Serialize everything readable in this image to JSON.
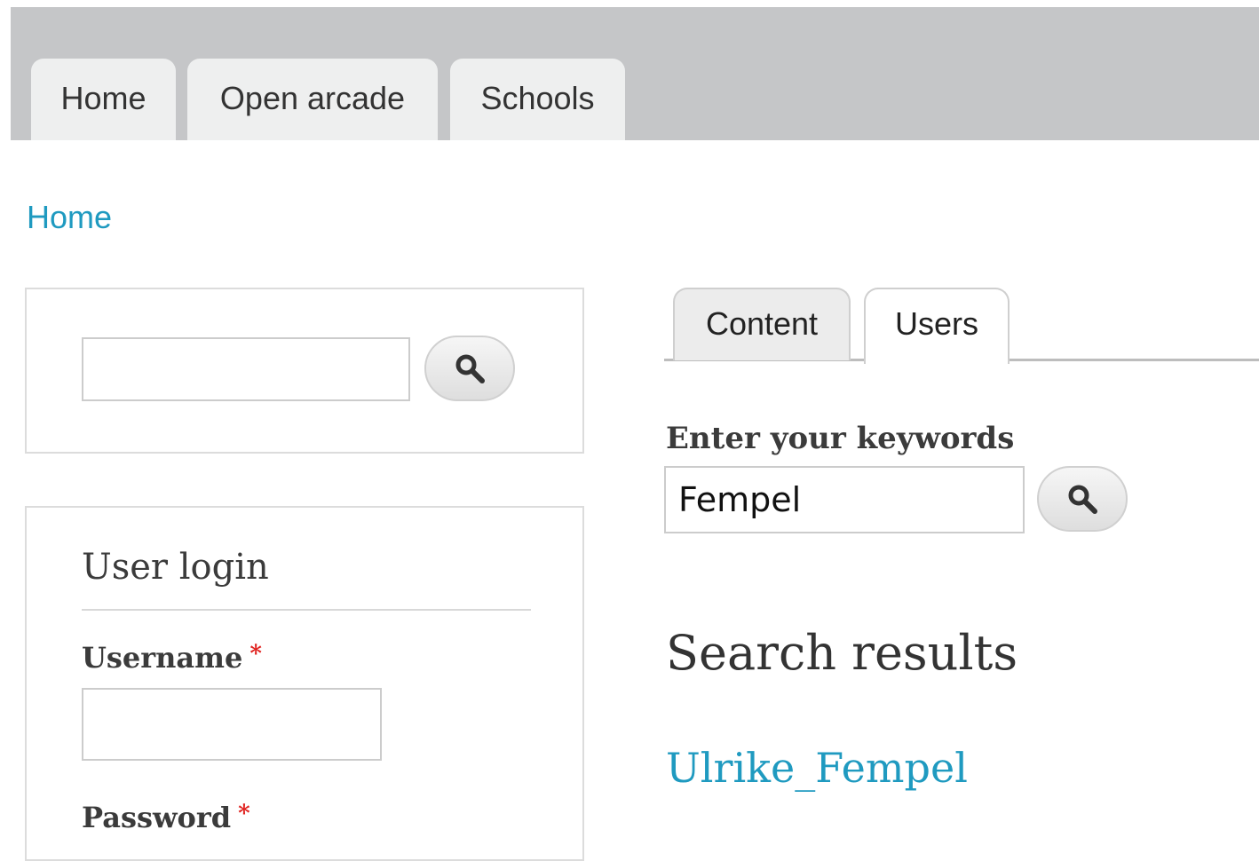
{
  "nav": {
    "tabs": [
      {
        "label": "Home"
      },
      {
        "label": "Open arcade"
      },
      {
        "label": "Schools"
      }
    ]
  },
  "breadcrumb": {
    "home": "Home"
  },
  "sidebar": {
    "search": {
      "value": "",
      "button_icon": "search-icon"
    },
    "login": {
      "title": "User login",
      "username_label": "Username",
      "password_label": "Password",
      "required_marker": "*",
      "username_value": ""
    }
  },
  "main": {
    "tabs": [
      {
        "label": "Content",
        "active": false
      },
      {
        "label": "Users",
        "active": true
      }
    ],
    "keywords_label": "Enter your keywords",
    "keywords_value": "Fempel",
    "results_heading": "Search results",
    "results": [
      {
        "title": "Ulrike_Fempel"
      }
    ]
  },
  "colors": {
    "link": "#1f9ac0",
    "required": "#e0221f",
    "topbar": "#c5c6c8"
  }
}
